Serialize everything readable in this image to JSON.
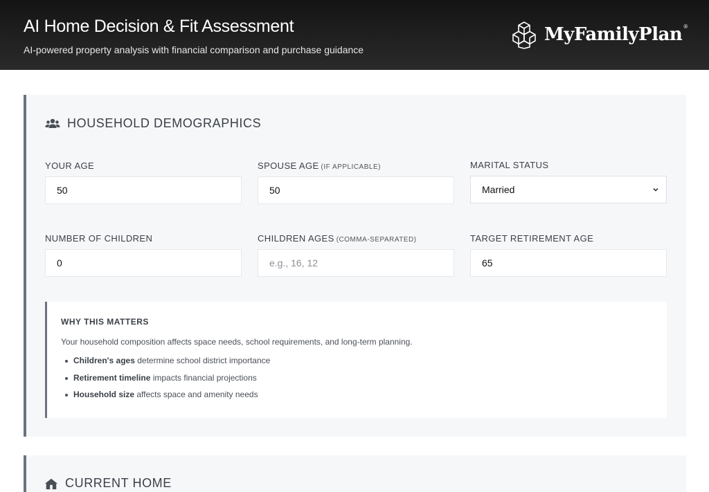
{
  "header": {
    "title": "AI Home Decision & Fit Assessment",
    "subtitle": "AI-powered property analysis with financial comparison and purchase guidance",
    "brand": {
      "name": "MyFamilyPlan",
      "reg": "®",
      "logo_icon": "hexagon-cubes-logo"
    }
  },
  "household": {
    "title": "HOUSEHOLD DEMOGRAPHICS",
    "icon": "users-icon",
    "your_age": {
      "label": "YOUR AGE",
      "value": "50"
    },
    "spouse_age": {
      "label": "SPOUSE AGE",
      "hint": "(IF APPLICABLE)",
      "value": "50"
    },
    "marital_status": {
      "label": "MARITAL STATUS",
      "value": "Married"
    },
    "num_children": {
      "label": "NUMBER OF CHILDREN",
      "value": "0"
    },
    "children_ages": {
      "label": "CHILDREN AGES",
      "hint": "(COMMA-SEPARATED)",
      "placeholder": "e.g., 16, 12"
    },
    "retirement_age": {
      "label": "TARGET RETIREMENT AGE",
      "value": "65"
    },
    "info": {
      "title": "WHY THIS MATTERS",
      "description": "Your household composition affects space needs, school requirements, and long-term planning.",
      "items": [
        {
          "bold": "Children's ages",
          "text": " determine school district importance"
        },
        {
          "bold": "Retirement timeline",
          "text": " impacts financial projections"
        },
        {
          "bold": "Household size",
          "text": " affects space and amenity needs"
        }
      ]
    }
  },
  "current_home": {
    "title": "CURRENT HOME",
    "icon": "home-icon"
  },
  "colors": {
    "header_bg": "#1e1e1e",
    "section_bg": "#f6f7f9",
    "accent_border": "#6b7280"
  }
}
